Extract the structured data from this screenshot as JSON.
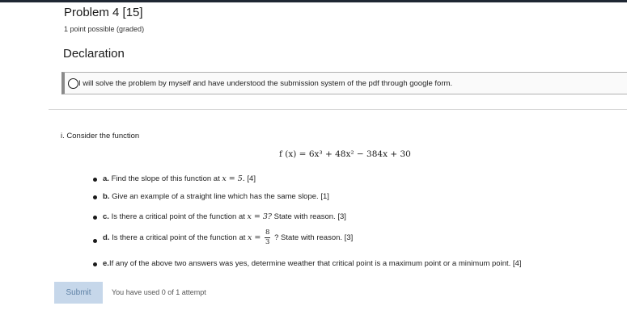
{
  "header": {
    "title": "Problem 4 [15]",
    "points": "1 point possible (graded)"
  },
  "declaration": {
    "heading": "Declaration",
    "option_label": "I will solve the problem by myself and have understood the submission system of the pdf through google form."
  },
  "problem": {
    "intro": "i. Consider the function",
    "formula_lhs": "f (x) = ",
    "formula_rhs": "6x³ + 48x² − 384x + 30",
    "questions": {
      "a": {
        "letter": "a.",
        "pre": "Find the slope of this function at",
        "cond": "x = 5.",
        "post": "[4]"
      },
      "b": {
        "letter": "b.",
        "text": "Give an example of a straight line which has the same slope. [1]"
      },
      "c": {
        "letter": "c.",
        "pre": "Is there a critical point of the function at",
        "cond": "x = 3?",
        "post": "State with reason. [3]"
      },
      "d": {
        "letter": "d.",
        "pre": "Is there a critical point of the function at",
        "cond": "x =",
        "num": "8",
        "den": "3",
        "post": "? State with reason. [3]"
      },
      "e": {
        "letter": "e.",
        "text": "If any of the above two answers was yes, determine weather that critical point is a maximum point or a minimum point. [4]"
      }
    }
  },
  "footer": {
    "submit_label": "Submit",
    "attempts_text": "You have used 0 of 1 attempt"
  }
}
